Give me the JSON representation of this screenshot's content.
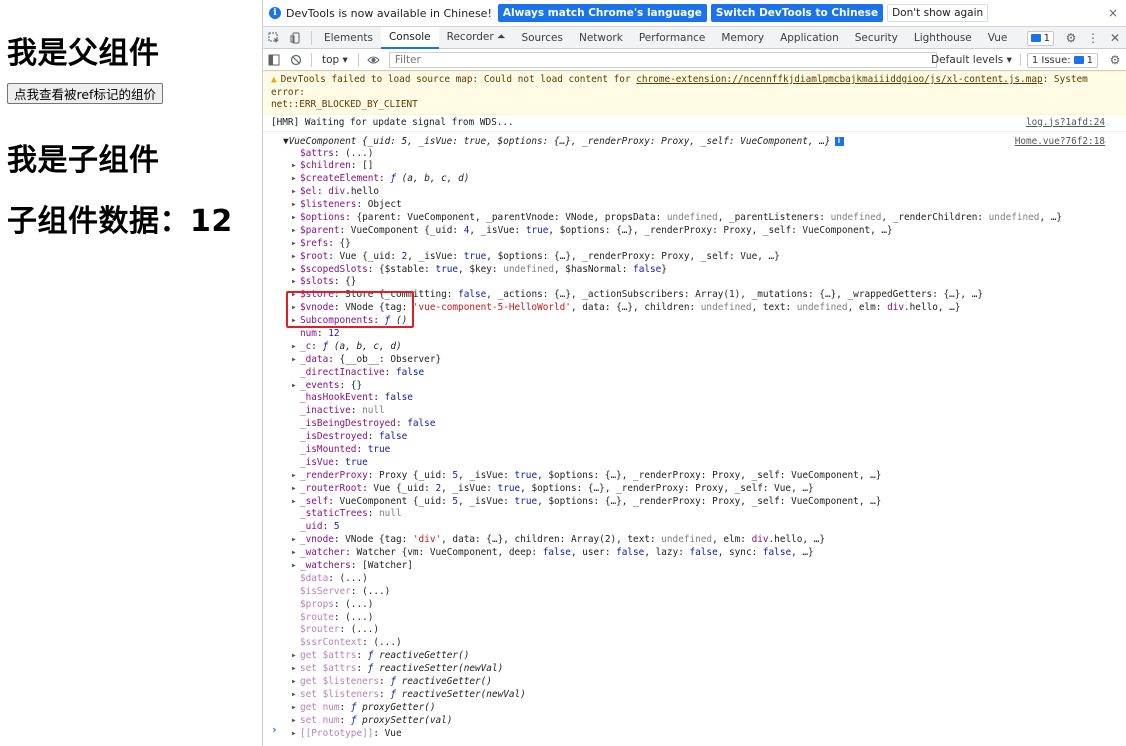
{
  "page": {
    "parent_heading": "我是父组件",
    "button_label": "点我查看被ref标记的组价",
    "child_heading": "我是子组件",
    "child_data": "子组件数据：12"
  },
  "banner": {
    "message": "DevTools is now available in Chinese!",
    "btn_match": "Always match Chrome's language",
    "btn_switch": "Switch DevTools to Chinese",
    "btn_dismiss": "Don't show again",
    "close": "×"
  },
  "tabs": {
    "items": [
      "Elements",
      "Console",
      "Recorder ⏶",
      "Sources",
      "Network",
      "Performance",
      "Memory",
      "Application",
      "Security",
      "Lighthouse",
      "Vue"
    ],
    "active": "Console",
    "messages_count": "1"
  },
  "toolbar": {
    "context": "top ▾",
    "filter_placeholder": "Filter",
    "levels": "Default levels ▾",
    "issues": "1 Issue:",
    "issues_count": "1"
  },
  "console": {
    "warning_text": "DevTools failed to load source map: Could not load content for ",
    "warning_link": "chrome-extension://ncennffkjdiamlpmcbajkmaiiiddgioo/js/xl-content.js.map",
    "warning_tail": ": System error:",
    "warning_line2": "net::ERR_BLOCKED_BY_CLIENT",
    "hmr_text": "[HMR] Waiting for update signal from WDS...",
    "hmr_source": "log.js?1afd:24",
    "object_summary": "▼VueComponent {_uid: 5, _isVue: true, $options: {…}, _renderProxy: Proxy, _self: VueComponent, …}",
    "object_source": "Home.vue?76f2:18"
  }
}
